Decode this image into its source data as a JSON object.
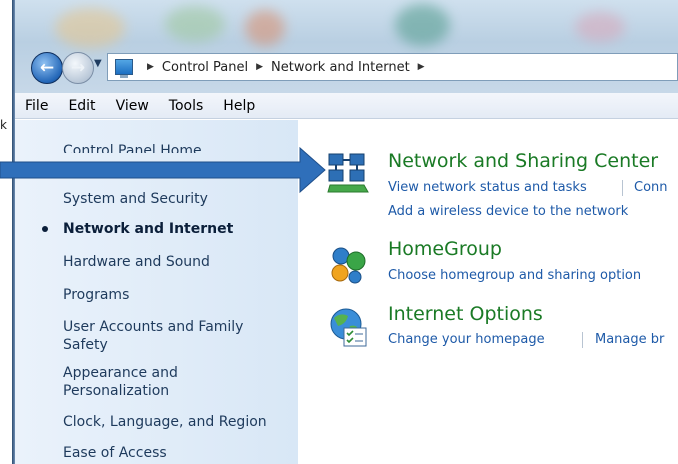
{
  "window": {
    "stray_text": "k",
    "breadcrumb": [
      "Control Panel",
      "Network and Internet"
    ]
  },
  "menubar": {
    "items": [
      "File",
      "Edit",
      "View",
      "Tools",
      "Help"
    ]
  },
  "sidebar": {
    "home": "Control Panel Home",
    "items": [
      "System and Security",
      "Network and Internet",
      "Hardware and Sound",
      "Programs",
      "User Accounts and Family Safety",
      "Appearance and Personalization",
      "Clock, Language, and Region",
      "Ease of Access"
    ],
    "active_index": 1
  },
  "main": {
    "categories": [
      {
        "title": "Network and Sharing Center",
        "icon": "network-icon",
        "links": [
          "View network status and tasks",
          "Conn",
          "Add a wireless device to the network"
        ]
      },
      {
        "title": "HomeGroup",
        "icon": "homegroup-icon",
        "links": [
          "Choose homegroup and sharing option"
        ]
      },
      {
        "title": "Internet Options",
        "icon": "internet-options-icon",
        "links": [
          "Change your homepage",
          "Manage br"
        ]
      }
    ]
  },
  "colors": {
    "category_title": "#1a7a25",
    "link": "#1e5aa8",
    "sidebar_text": "#1e3a5c",
    "pointer_arrow": "#2f6fba"
  }
}
